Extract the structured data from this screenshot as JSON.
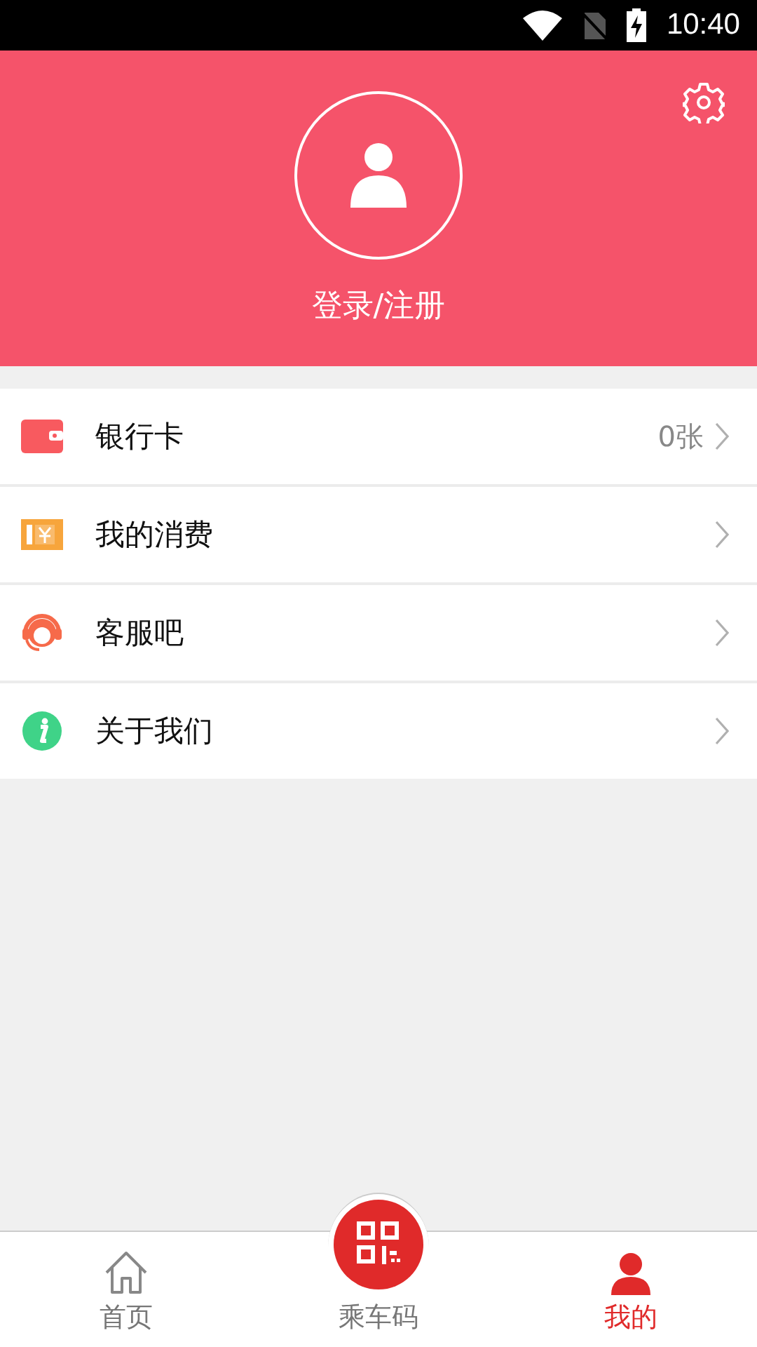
{
  "status_bar": {
    "time": "10:40"
  },
  "header": {
    "login_label": "登录/注册"
  },
  "menu": [
    {
      "kind": "card",
      "label": "银行卡",
      "value": "0张"
    },
    {
      "kind": "ticket",
      "label": "我的消费"
    },
    {
      "kind": "service",
      "label": "客服吧"
    },
    {
      "kind": "info",
      "label": "关于我们"
    }
  ],
  "nav": [
    {
      "kind": "home",
      "label": "首页",
      "selected": false
    },
    {
      "kind": "qr",
      "label": "乘车码",
      "selected": false
    },
    {
      "kind": "me",
      "label": "我的",
      "selected": true
    }
  ]
}
